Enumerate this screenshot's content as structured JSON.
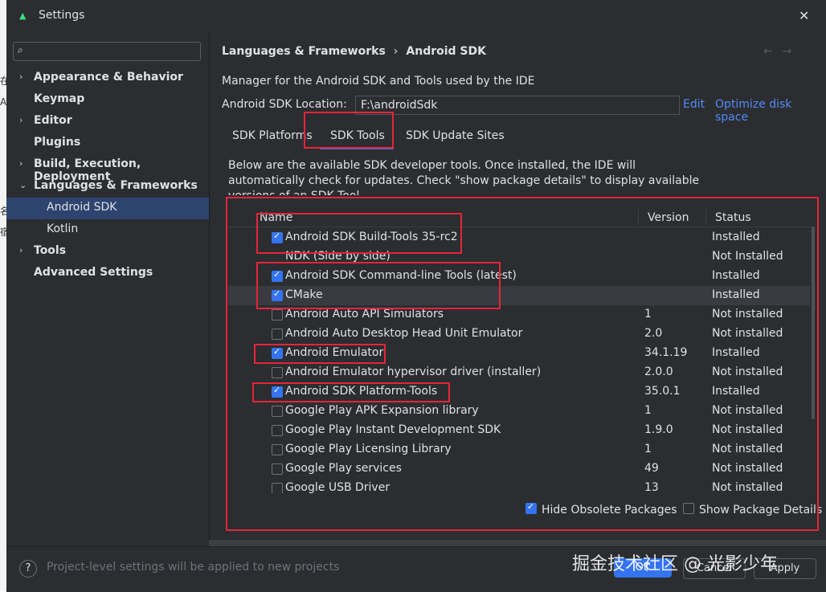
{
  "window": {
    "title": "Settings"
  },
  "background_fragments": [
    "在",
    "A",
    "名",
    "宿"
  ],
  "sidebar": {
    "search_placeholder": "",
    "items": [
      {
        "label": "Appearance & Behavior",
        "chevron": "›"
      },
      {
        "label": "Keymap",
        "chevron": ""
      },
      {
        "label": "Editor",
        "chevron": "›"
      },
      {
        "label": "Plugins",
        "chevron": ""
      },
      {
        "label": "Build, Execution, Deployment",
        "chevron": "›"
      },
      {
        "label": "Languages & Frameworks",
        "chevron": "⌄"
      },
      {
        "label": "Android SDK",
        "chevron": ""
      },
      {
        "label": "Kotlin",
        "chevron": ""
      },
      {
        "label": "Tools",
        "chevron": "›"
      },
      {
        "label": "Advanced Settings",
        "chevron": ""
      }
    ]
  },
  "header": {
    "breadcrumb_parent": "Languages & Frameworks",
    "breadcrumb_sep": "›",
    "breadcrumb_current": "Android SDK",
    "back": "←",
    "forward": "→"
  },
  "main": {
    "description": "Manager for the Android SDK and Tools used by the IDE",
    "location_label": "Android SDK Location:",
    "location_value": "F:\\androidSdk",
    "edit_link": "Edit",
    "optimize_link": "Optimize disk space",
    "tabs": [
      "SDK Platforms",
      "SDK Tools",
      "SDK Update Sites"
    ],
    "note": "Below are the available SDK developer tools. Once installed, the IDE will automatically check for updates. Check \"show package details\" to display available versions of an SDK Tool."
  },
  "table": {
    "headers": {
      "name": "Name",
      "version": "Version",
      "status": "Status"
    },
    "rows": [
      {
        "name": "Android SDK Build-Tools 35-rc2",
        "version": "",
        "status": "Installed",
        "checked": true
      },
      {
        "name": "NDK (Side by side)",
        "version": "",
        "status": "Not Installed",
        "checked": null
      },
      {
        "name": "Android SDK Command-line Tools (latest)",
        "version": "",
        "status": "Installed",
        "checked": true
      },
      {
        "name": "CMake",
        "version": "",
        "status": "Installed",
        "checked": true
      },
      {
        "name": "Android Auto API Simulators",
        "version": "1",
        "status": "Not installed",
        "checked": false
      },
      {
        "name": "Android Auto Desktop Head Unit Emulator",
        "version": "2.0",
        "status": "Not installed",
        "checked": false
      },
      {
        "name": "Android Emulator",
        "version": "34.1.19",
        "status": "Installed",
        "checked": true
      },
      {
        "name": "Android Emulator hypervisor driver (installer)",
        "version": "2.0.0",
        "status": "Not installed",
        "checked": false
      },
      {
        "name": "Android SDK Platform-Tools",
        "version": "35.0.1",
        "status": "Installed",
        "checked": true
      },
      {
        "name": "Google Play APK Expansion library",
        "version": "1",
        "status": "Not installed",
        "checked": false
      },
      {
        "name": "Google Play Instant Development SDK",
        "version": "1.9.0",
        "status": "Not installed",
        "checked": false
      },
      {
        "name": "Google Play Licensing Library",
        "version": "1",
        "status": "Not installed",
        "checked": false
      },
      {
        "name": "Google Play services",
        "version": "49",
        "status": "Not installed",
        "checked": false
      },
      {
        "name": "Google USB Driver",
        "version": "13",
        "status": "Not installed",
        "checked": false
      }
    ]
  },
  "options": {
    "hide_obsolete": "Hide Obsolete Packages",
    "hide_obsolete_checked": true,
    "show_details": "Show Package Details",
    "show_details_checked": false
  },
  "footer": {
    "help": "?",
    "note": "Project-level settings will be applied to new projects",
    "ok": "OK",
    "cancel": "Cancel",
    "apply": "Apply"
  },
  "watermark": "掘金技术社区 @ 光影少年",
  "colors": {
    "accent": "#3574f0",
    "annotation": "#e5243b",
    "link": "#548af7"
  }
}
